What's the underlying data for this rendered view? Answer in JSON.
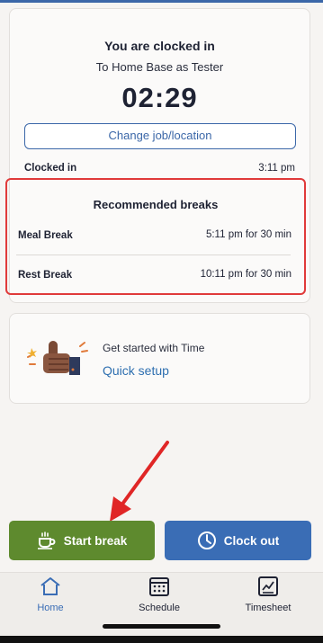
{
  "status": {
    "title": "You are clocked in",
    "subtitle": "To Home Base as Tester",
    "timer": "02:29",
    "change_button": "Change job/location",
    "clocked_in_label": "Clocked in",
    "clocked_in_time": "3:11 pm"
  },
  "breaks": {
    "title": "Recommended breaks",
    "items": [
      {
        "label": "Meal Break",
        "value": "5:11 pm for 30 min"
      },
      {
        "label": "Rest Break",
        "value": "10:11 pm for 30 min"
      }
    ],
    "highlight_color": "#e03a3a"
  },
  "setup": {
    "label": "Get started with Time",
    "link": "Quick setup",
    "illustration_icon": "thumbs-up-icon"
  },
  "actions": {
    "start_break": "Start break",
    "start_break_icon": "coffee-cup-icon",
    "start_break_color": "#5e8a2e",
    "clock_out": "Clock out",
    "clock_out_icon": "clock-icon",
    "clock_out_color": "#3a6db5"
  },
  "nav": {
    "items": [
      {
        "label": "Home",
        "icon": "home-icon",
        "active": true
      },
      {
        "label": "Schedule",
        "icon": "calendar-icon",
        "active": false
      },
      {
        "label": "Timesheet",
        "icon": "timesheet-icon",
        "active": false
      }
    ],
    "active_color": "#3a6db5"
  },
  "annotation": {
    "arrow_color": "#e02626"
  }
}
